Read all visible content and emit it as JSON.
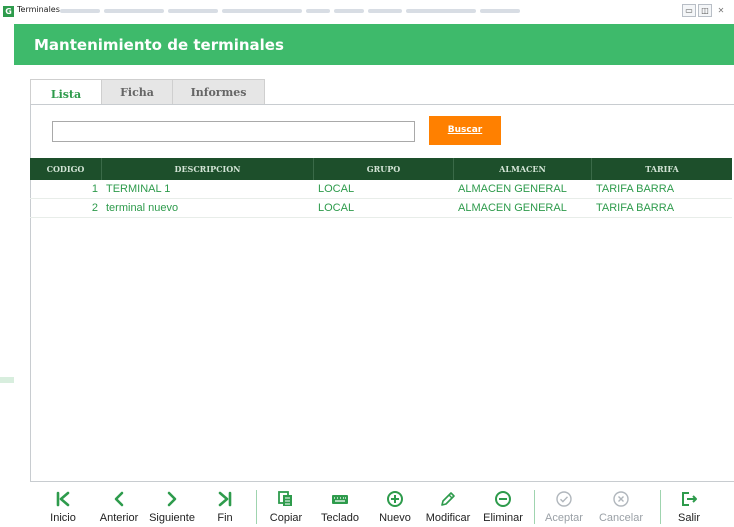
{
  "window": {
    "app_logo": "G",
    "title": "Terminales"
  },
  "header": {
    "title": "Mantenimiento de terminales"
  },
  "tabs": [
    {
      "label": "Lista",
      "active": true
    },
    {
      "label": "Ficha",
      "active": false
    },
    {
      "label": "Informes",
      "active": false
    }
  ],
  "search": {
    "value": "",
    "button_label": "Buscar"
  },
  "table": {
    "columns": [
      "CODIGO",
      "DESCRIPCION",
      "GRUPO",
      "ALMACEN",
      "TARIFA"
    ],
    "rows": [
      {
        "codigo": "1",
        "descripcion": "TERMINAL 1",
        "grupo": "LOCAL",
        "almacen": "ALMACEN GENERAL",
        "tarifa": "TARIFA BARRA"
      },
      {
        "codigo": "2",
        "descripcion": "terminal nuevo",
        "grupo": "LOCAL",
        "almacen": "ALMACEN GENERAL",
        "tarifa": "TARIFA BARRA"
      }
    ]
  },
  "toolbar": {
    "inicio": "Inicio",
    "anterior": "Anterior",
    "siguiente": "Siguiente",
    "fin": "Fin",
    "copiar": "Copiar",
    "teclado": "Teclado",
    "nuevo": "Nuevo",
    "modificar": "Modificar",
    "eliminar": "Eliminar",
    "aceptar": "Aceptar",
    "cancelar": "Cancelar",
    "salir": "Salir"
  },
  "colors": {
    "header_green": "#3eba6b",
    "table_header": "#1d4f2b",
    "row_text": "#2e9b4c",
    "search_button": "#ff8000"
  }
}
